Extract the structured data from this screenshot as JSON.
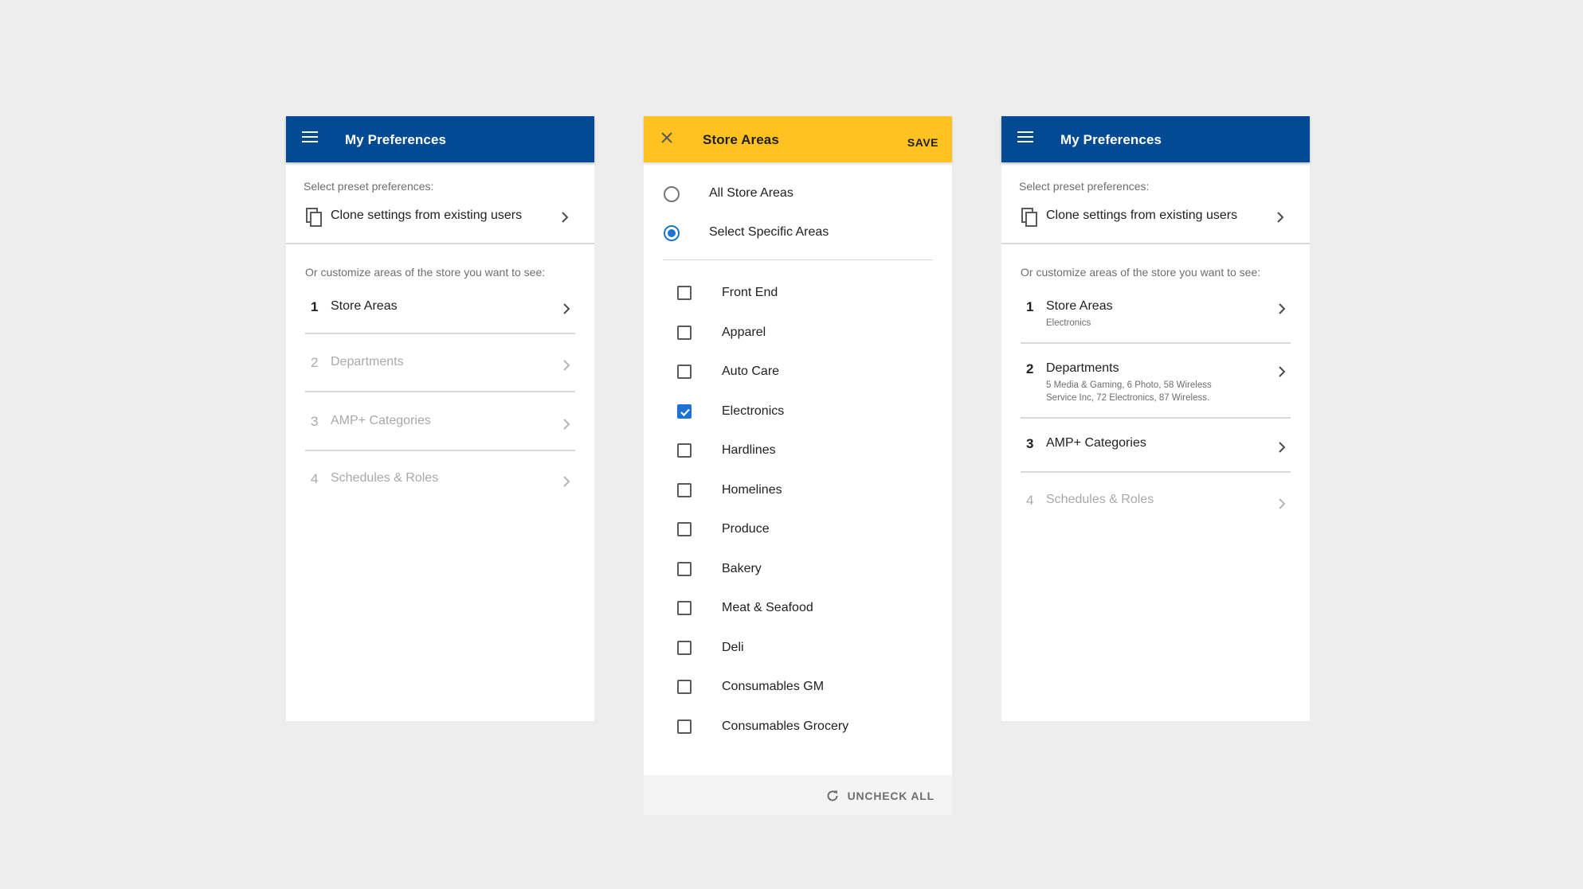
{
  "colors": {
    "background": "#ededed",
    "primary_blue": "#034a94",
    "accent_yellow": "#ffc220",
    "selection_blue": "#1e73d2"
  },
  "left": {
    "appbar": {
      "title": "My Preferences",
      "menu_icon": "menu-icon"
    },
    "preset_label": "Select preset preferences:",
    "clone_label": "Clone settings from existing users",
    "customize_label": "Or customize areas of the store you want to see:",
    "steps": [
      {
        "num": "1",
        "label": "Store Areas"
      },
      {
        "num": "2",
        "label": "Departments"
      },
      {
        "num": "3",
        "label": "AMP+ Categories"
      },
      {
        "num": "4",
        "label": "Schedules & Roles"
      }
    ]
  },
  "middle": {
    "appbar": {
      "title": "Store Areas",
      "save_label": "SAVE",
      "close_icon": "close-icon"
    },
    "radios": [
      {
        "label": "All Store Areas",
        "selected": false
      },
      {
        "label": "Select Specific Areas",
        "selected": true
      }
    ],
    "areas": [
      {
        "label": "Front End",
        "checked": false
      },
      {
        "label": "Apparel",
        "checked": false
      },
      {
        "label": "Auto Care",
        "checked": false
      },
      {
        "label": "Electronics",
        "checked": true
      },
      {
        "label": "Hardlines",
        "checked": false
      },
      {
        "label": "Homelines",
        "checked": false
      },
      {
        "label": "Produce",
        "checked": false
      },
      {
        "label": "Bakery",
        "checked": false
      },
      {
        "label": "Meat & Seafood",
        "checked": false
      },
      {
        "label": "Deli",
        "checked": false
      },
      {
        "label": "Consumables GM",
        "checked": false
      },
      {
        "label": "Consumables Grocery",
        "checked": false
      }
    ],
    "footer": {
      "uncheck_label": "UNCHECK ALL",
      "icon": "refresh-icon"
    }
  },
  "right": {
    "appbar": {
      "title": "My Preferences",
      "menu_icon": "menu-icon"
    },
    "preset_label": "Select preset preferences:",
    "clone_label": "Clone settings from existing users",
    "customize_label": "Or customize areas of the store you want to see:",
    "steps": [
      {
        "num": "1",
        "label": "Store Areas",
        "sub": "Electronics"
      },
      {
        "num": "2",
        "label": "Departments",
        "sub": "5 Media & Gaming,  6 Photo,  58 Wireless Service Inc, 72 Electronics,  87 Wireless."
      },
      {
        "num": "3",
        "label": "AMP+ Categories"
      },
      {
        "num": "4",
        "label": "Schedules & Roles"
      }
    ]
  }
}
